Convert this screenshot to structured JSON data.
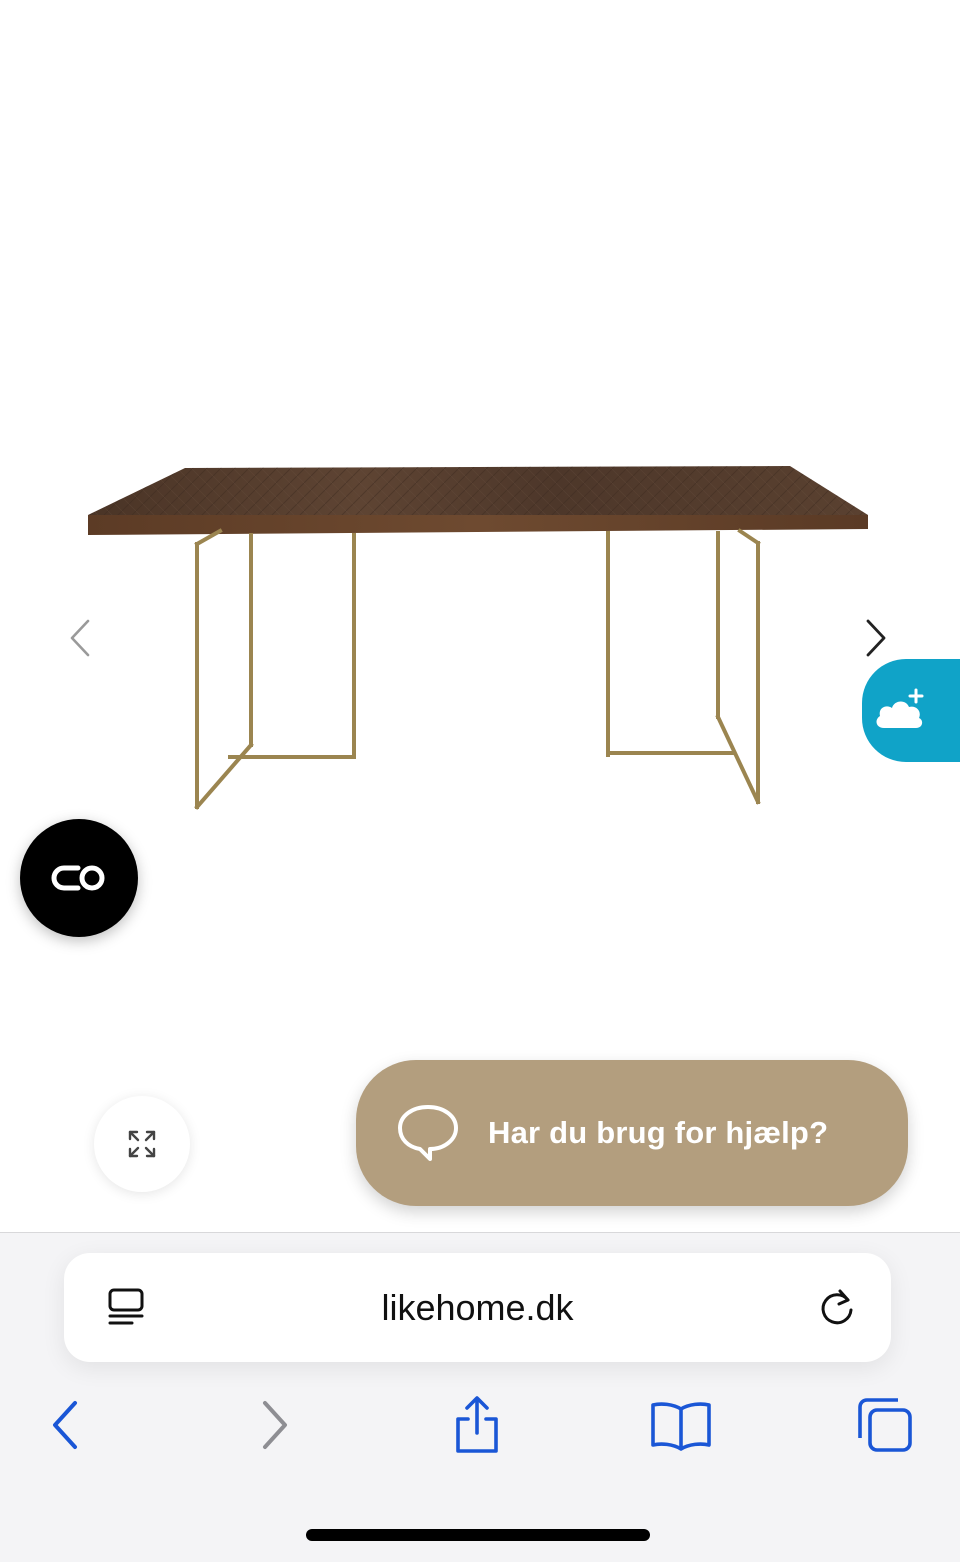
{
  "product": {
    "image_icon": "dining-table-image"
  },
  "carousel": {
    "prev_icon": "chevron-left-icon",
    "next_icon": "chevron-right-icon"
  },
  "widgets": {
    "cloud_icon": "cloud-plus-icon",
    "cloud_color": "#10a3c8",
    "co_icon": "co-logo-icon",
    "zoom_icon": "expand-icon"
  },
  "help": {
    "label": "Har du brug for hjælp?",
    "icon": "chat-bubble-icon",
    "color": "#b39e7e"
  },
  "browser": {
    "url": "likehome.dk",
    "reader_icon": "page-menu-icon",
    "reload_icon": "reload-icon",
    "accent_color": "#1a56d6",
    "toolbar": {
      "back_icon": "back-icon",
      "forward_icon": "forward-icon",
      "share_icon": "share-icon",
      "bookmarks_icon": "bookmarks-icon",
      "tabs_icon": "tabs-icon"
    }
  }
}
